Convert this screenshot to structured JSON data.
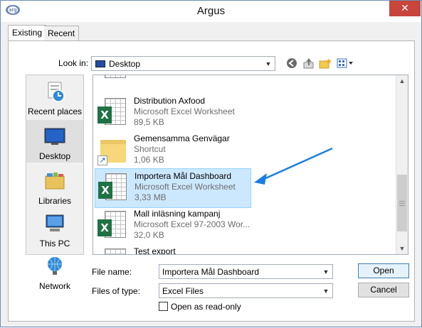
{
  "window": {
    "title": "Argus",
    "close_label": "✕",
    "app_icon_text": "arg"
  },
  "tabs": [
    {
      "label": "Existing"
    },
    {
      "label": "Recent"
    }
  ],
  "lookin": {
    "label": "Look in:",
    "value": "Desktop"
  },
  "toolbar": [
    "back-icon",
    "up-folder-icon",
    "new-folder-icon",
    "view-menu-icon"
  ],
  "places": [
    {
      "label": "Recent places",
      "icon": "recent-places-icon"
    },
    {
      "label": "Desktop",
      "icon": "desktop-icon",
      "selected": true
    },
    {
      "label": "Libraries",
      "icon": "libraries-icon"
    },
    {
      "label": "This PC",
      "icon": "computer-icon"
    },
    {
      "label": "Network",
      "icon": "network-icon"
    }
  ],
  "files": [
    {
      "name": "Distribution Axfood",
      "type": "Microsoft Excel Worksheet",
      "size": "89,5 KB",
      "icon": "excel-icon"
    },
    {
      "name": "Gemensamma Genvägar",
      "type": "Shortcut",
      "size": "1,06 KB",
      "icon": "folder-shortcut-icon"
    },
    {
      "name": "Importera Mål Dashboard",
      "type": "Microsoft Excel Worksheet",
      "size": "3,33 MB",
      "icon": "excel-icon",
      "selected": true
    },
    {
      "name": "Mall inläsning kampanj",
      "type": "Microsoft Excel 97-2003 Wor...",
      "size": "32,0 KB",
      "icon": "excel-icon"
    },
    {
      "name": "Test export",
      "type": "",
      "size": "",
      "icon": "excel-icon"
    }
  ],
  "filename": {
    "label": "File name:",
    "value": "Importera Mål Dashboard"
  },
  "filetype": {
    "label": "Files of type:",
    "value": "Excel Files"
  },
  "readonly": {
    "label": "Open as read-only",
    "checked": false
  },
  "buttons": {
    "open": "Open",
    "cancel": "Cancel"
  },
  "colors": {
    "accent": "#1a7fe0",
    "excel": "#1f7244",
    "close": "#c7453b",
    "selection": "#cce8ff"
  }
}
